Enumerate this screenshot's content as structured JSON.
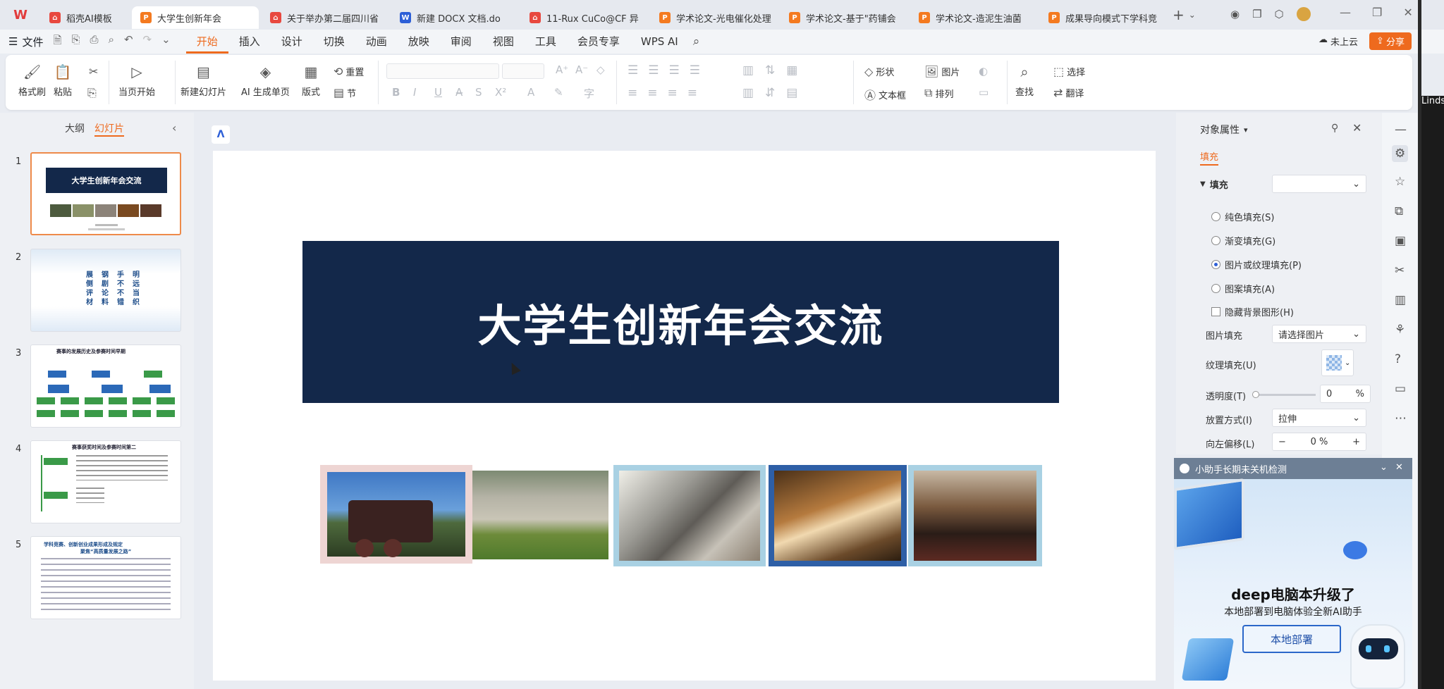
{
  "tabs": [
    {
      "label": "稻壳AI模板",
      "icon": "k"
    },
    {
      "label": "大学生创新年会",
      "icon": "p"
    },
    {
      "label": "关于举办第二届四川省",
      "icon": "r"
    },
    {
      "label": "新建 DOCX 文档.do",
      "icon": "w"
    },
    {
      "label": "11-Rux CuCo@CF 异",
      "icon": "r"
    },
    {
      "label": "学术论文-光电催化处理",
      "icon": "p"
    },
    {
      "label": "学术论文-基于\"药铺会",
      "icon": "p"
    },
    {
      "label": "学术论文-造泥生油菌",
      "icon": "p"
    },
    {
      "label": "成果导向模式下学科竞",
      "icon": "p"
    }
  ],
  "menubar": {
    "file": "文件",
    "items": [
      "开始",
      "插入",
      "设计",
      "切换",
      "动画",
      "放映",
      "审阅",
      "视图",
      "工具",
      "会员专享",
      "WPS AI"
    ],
    "unsaved": "未上云",
    "share": "分享"
  },
  "ribbon": {
    "format_painter": "格式刷",
    "paste": "粘贴",
    "start_from_current": "当页开始",
    "new_slide": "新建幻灯片",
    "ai_single": "AI 生成单页",
    "layout": "版式",
    "reset": "重置",
    "section": "节",
    "shape": "形状",
    "picture": "图片",
    "textbox": "文本框",
    "arrange": "排列",
    "find": "查找",
    "select": "选择",
    "translate": "翻译"
  },
  "left_panel": {
    "outline": "大纲",
    "slides": "幻灯片"
  },
  "slide_numbers": [
    "1",
    "2",
    "3",
    "4",
    "5"
  ],
  "thumb_text": {
    "s1_title": "大学生创新年会交流",
    "s2_cols": [
      "展\n侧\n评\n材",
      "钢\n剧\n论\n料",
      "手\n不\n不\n错",
      "明\n远\n当\n织"
    ],
    "s3_title": "赛事的发展历史及参赛时间早期",
    "s4_title": "赛事获奖时间及参赛时间第二",
    "s5_title": "学科竞赛、创新创业成果形成及规定",
    "s5_sub": "聚焦“高质量发展之路”"
  },
  "slide": {
    "title": "大学生创新年会交流"
  },
  "panel": {
    "title": "对象属性",
    "tab_fill": "填充",
    "section_fill": "填充",
    "opt_solid": "纯色填充(S)",
    "opt_gradient": "渐变填充(G)",
    "opt_picture": "图片或纹理填充(P)",
    "opt_pattern": "图案填充(A)",
    "opt_hide_bg": "隐藏背景图形(H)",
    "picture_fill": "图片填充",
    "picture_fill_value": "请选择图片",
    "texture_fill": "纹理填充(U)",
    "transparency": "透明度(T)",
    "transparency_value": "0",
    "percent": "%",
    "placement": "放置方式(I)",
    "placement_value": "拉伸",
    "offset_left": "向左偏移(L)",
    "offset_value": "0 %"
  },
  "ad": {
    "header": "小助手长期未关机检测",
    "headline": "deep电脑本升级了",
    "subline": "本地部署到电脑体验全新AI助手",
    "button": "本地部署"
  },
  "right_edge": "Linds",
  "colors": {
    "accent": "#ee6a1e",
    "navy": "#13284a",
    "ribbon_bg": "#ffffff",
    "app_bg": "#e9ecf2"
  }
}
